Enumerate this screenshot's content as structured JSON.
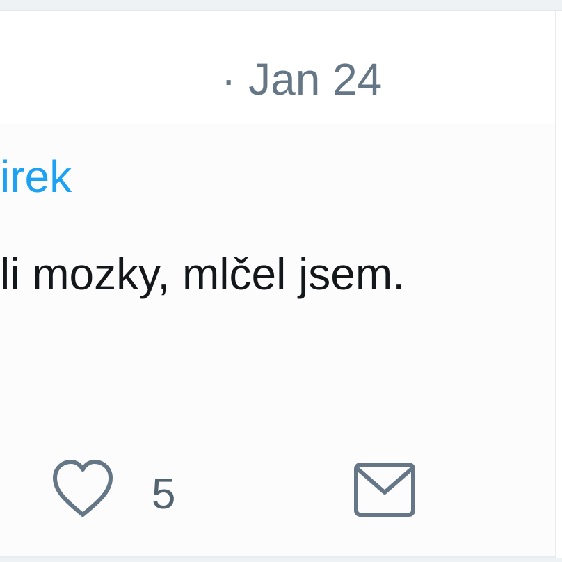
{
  "tweet": {
    "timestamp": "· Jan 24",
    "mention": "irek",
    "text": "li mozky, mlčel jsem."
  },
  "actions": {
    "like_icon": "heart-icon",
    "like_count": "5",
    "message_icon": "envelope-icon"
  },
  "colors": {
    "mention": "#1da1f2",
    "text": "#14171a",
    "muted": "#657786",
    "icon": "#657786"
  }
}
